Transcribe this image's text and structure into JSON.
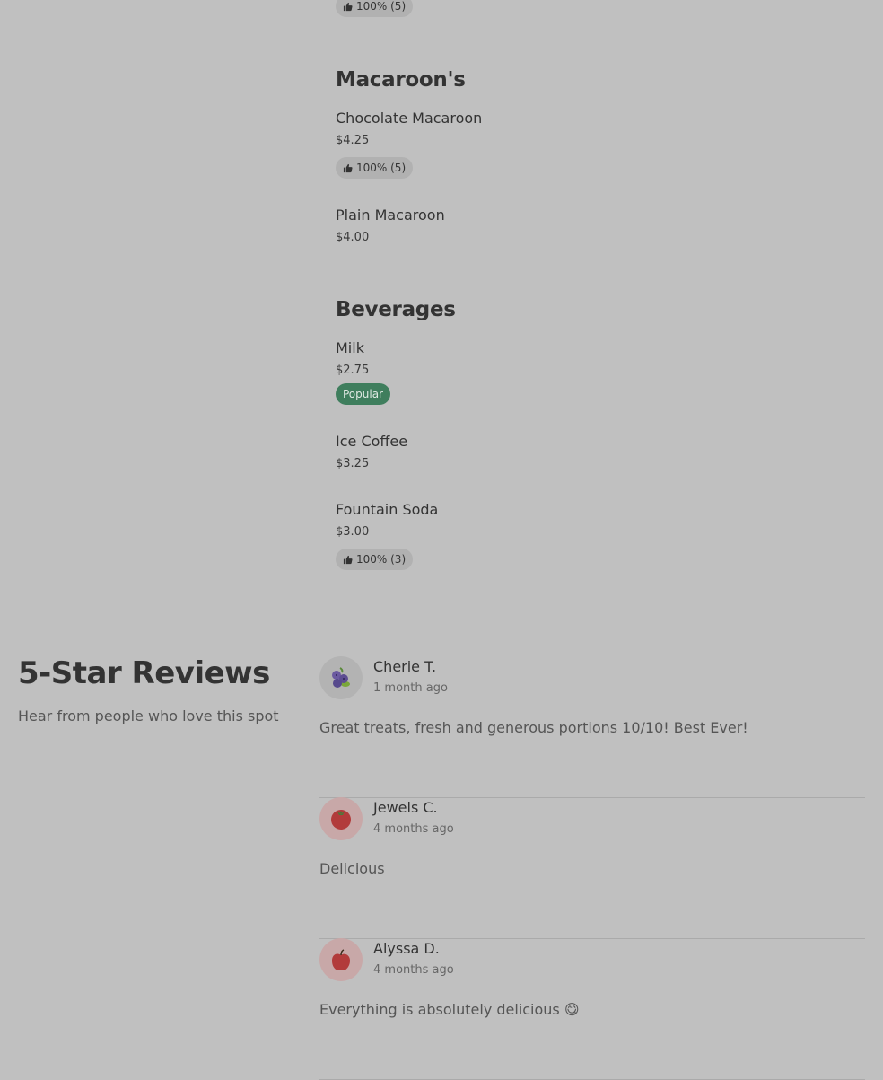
{
  "menu": {
    "top_rating": "100% (5)",
    "categories": [
      {
        "title": "Macaroon's",
        "items": [
          {
            "name": "Chocolate Macaroon",
            "price": "$4.25",
            "rating": "100% (5)"
          },
          {
            "name": "Plain Macaroon",
            "price": "$4.00"
          }
        ]
      },
      {
        "title": "Beverages",
        "items": [
          {
            "name": "Milk",
            "price": "$2.75",
            "badge": "Popular"
          },
          {
            "name": "Ice Coffee",
            "price": "$3.25"
          },
          {
            "name": "Fountain Soda",
            "price": "$3.00",
            "rating": "100% (3)"
          }
        ]
      }
    ]
  },
  "reviews": {
    "heading": "5-Star Reviews",
    "subheading": "Hear from people who love this spot",
    "items": [
      {
        "name": "Cherie T.",
        "time": "1 month ago",
        "text": "Great treats, fresh and generous portions 10/10! Best Ever!",
        "avatar_icon": "blueberries-icon",
        "avatar_color": "#b3b3b3"
      },
      {
        "name": "Jewels C.",
        "time": "4 months ago",
        "text": "Delicious",
        "avatar_icon": "tomato-icon",
        "avatar_color": "#c8a8a8"
      },
      {
        "name": "Alyssa D.",
        "time": "4 months ago",
        "text": "Everything is absolutely delicious 😋",
        "avatar_icon": "apple-icon",
        "avatar_color": "#c8a8a8"
      }
    ]
  },
  "colors": {
    "background": "#c0c0c0",
    "popular_badge": "#3f7e5d",
    "rating_pill": "#b1b1b1"
  }
}
